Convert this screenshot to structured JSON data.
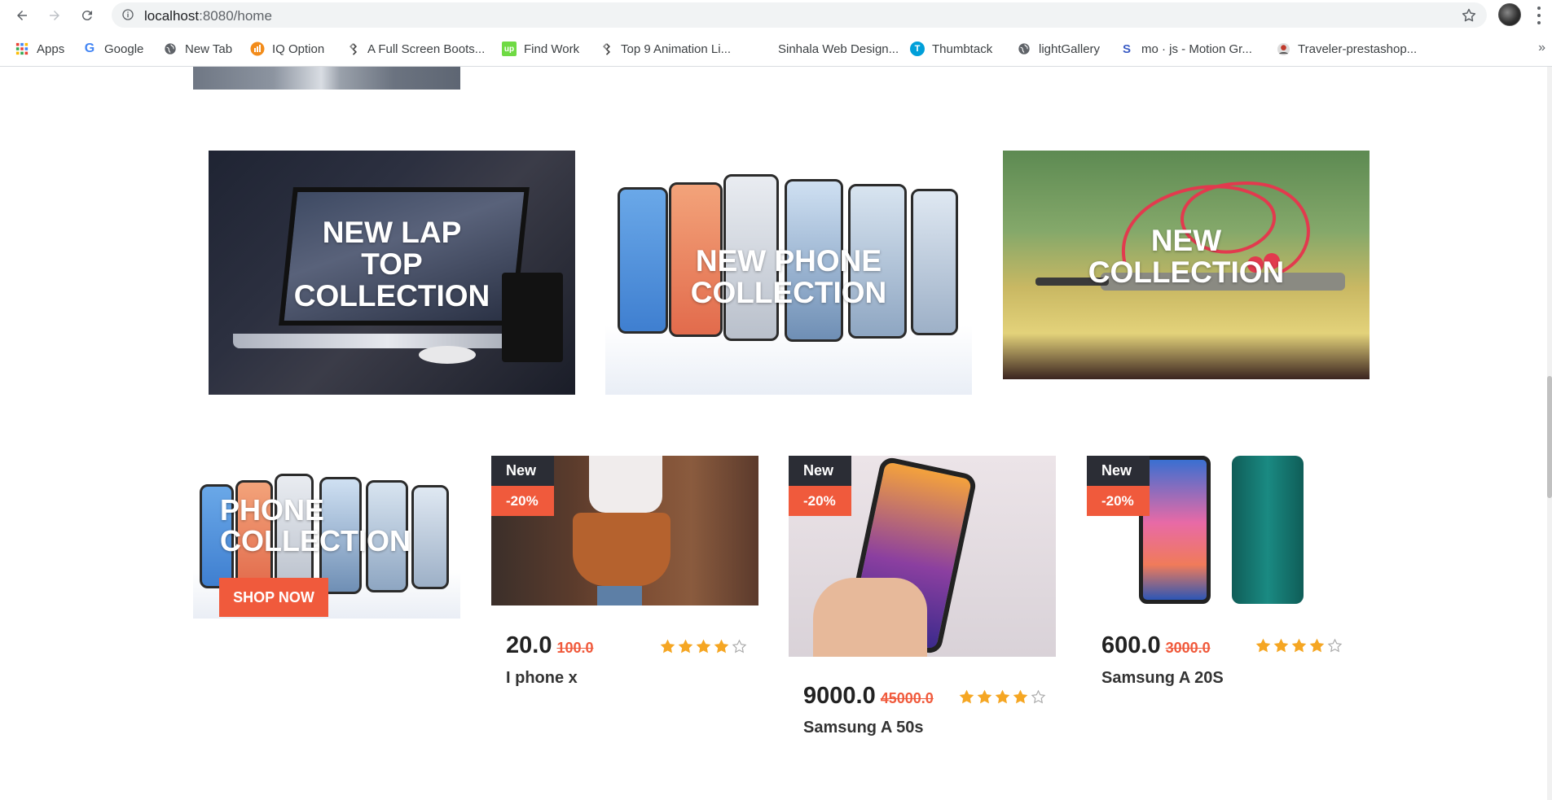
{
  "browser": {
    "url_host": "localhost",
    "url_path": ":8080/home",
    "bookmarks": [
      {
        "label": "Apps",
        "icon": "apps-grid-icon"
      },
      {
        "label": "Google",
        "icon": "google-icon"
      },
      {
        "label": "New Tab",
        "icon": "globe-icon"
      },
      {
        "label": "IQ Option",
        "icon": "iq-option-icon"
      },
      {
        "label": "A Full Screen Boots...",
        "icon": "diamond-icon"
      },
      {
        "label": "Find Work",
        "icon": "upwork-icon"
      },
      {
        "label": "Top 9 Animation Li...",
        "icon": "diamond-icon"
      },
      {
        "label": "Sinhala Web Design...",
        "icon": "blank-icon"
      },
      {
        "label": "Thumbtack",
        "icon": "thumbtack-icon"
      },
      {
        "label": "lightGallery",
        "icon": "globe-icon"
      },
      {
        "label": "mo · js - Motion Gr...",
        "icon": "mojs-icon"
      },
      {
        "label": "Traveler-prestashop...",
        "icon": "traveler-icon"
      }
    ],
    "more_label": "»"
  },
  "banners": {
    "laptop": {
      "line1": "NEW LAP",
      "line2": "TOP",
      "line3": "COLLECTION"
    },
    "phone": {
      "line1": "NEW PHONE",
      "line2": "COLLECTION"
    },
    "collection": {
      "line1": "NEW",
      "line2": "COLLECTION"
    },
    "phone_small": {
      "line1": "PHONE",
      "line2": "COLLECTION",
      "button": "SHOP NOW"
    }
  },
  "products": [
    {
      "badge": "New",
      "discount": "-20%",
      "price": "20.0",
      "old_price": "100.0",
      "rating": 4,
      "name": "I phone x"
    },
    {
      "badge": "New",
      "discount": "-20%",
      "price": "9000.0",
      "old_price": "45000.0",
      "rating": 4,
      "name": "Samsung A 50s"
    },
    {
      "badge": "New",
      "discount": "-20%",
      "price": "600.0",
      "old_price": "3000.0",
      "rating": 4,
      "name": "Samsung A 20S"
    }
  ],
  "colors": {
    "accent": "#f05a3c",
    "badge_dark": "#2b2d35",
    "star": "#f5a623"
  }
}
